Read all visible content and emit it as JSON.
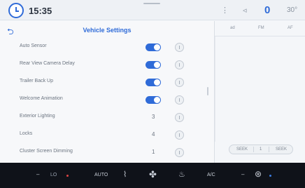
{
  "status_bar": {
    "time": "15:35",
    "indicator_number": "0",
    "temperature": "30°"
  },
  "panel": {
    "title": "Vehicle Settings",
    "back_icon": "back-arrow-icon"
  },
  "settings": [
    {
      "label": "Auto Sensor",
      "control": "toggle",
      "on": true
    },
    {
      "label": "Rear View Camera Delay",
      "control": "toggle",
      "on": true
    },
    {
      "label": "Trailer Back Up",
      "control": "toggle",
      "on": true
    },
    {
      "label": "Welcome Animation",
      "control": "toggle",
      "on": true
    },
    {
      "label": "Exterior Lighting",
      "control": "value",
      "value": "3"
    },
    {
      "label": "Locks",
      "control": "value",
      "value": "4"
    },
    {
      "label": "Cluster Screen Dimming",
      "control": "value",
      "value": "1"
    }
  ],
  "right_panel": {
    "tabs": [
      "ad",
      "FM",
      "AF"
    ],
    "segment": [
      "SEEK",
      "1",
      "SEEK"
    ]
  },
  "climate_bar": {
    "left_temp": "LO",
    "auto_label": "AUTO",
    "ac_label": "A/C",
    "colors": {
      "heat": "#dd4444",
      "cool": "#3b7be0"
    }
  },
  "colors": {
    "accent": "#2f6bd8",
    "background": "#f4f6f9",
    "bottom_bar": "#0f1219"
  }
}
